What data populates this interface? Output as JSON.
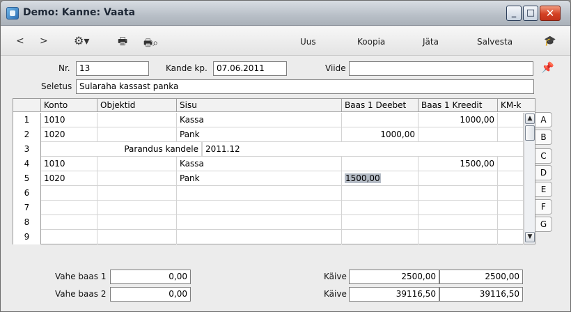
{
  "window": {
    "title": "Demo: Kanne: Vaata"
  },
  "toolbar": {
    "back_icon": "<",
    "forward_icon": ">",
    "new_label": "Uus",
    "copy_label": "Koopia",
    "skip_label": "Jäta",
    "save_label": "Salvesta"
  },
  "header": {
    "nr_label": "Nr.",
    "nr_value": "13",
    "date_label": "Kande kp.",
    "date_value": "07.06.2011",
    "ref_label": "Viide",
    "ref_value": "",
    "desc_label": "Seletus",
    "desc_value": "Sularaha kassast panka"
  },
  "grid": {
    "columns": [
      "",
      "Konto",
      "Objektid",
      "Sisu",
      "Baas 1 Deebet",
      "Baas 1 Kreedit",
      "KM-k"
    ],
    "rows": [
      {
        "n": "1",
        "konto": "1010",
        "objektid": "",
        "sisu": "Kassa",
        "deebet": "",
        "kreedit": "1000,00",
        "kmk": ""
      },
      {
        "n": "2",
        "konto": "1020",
        "objektid": "",
        "sisu": "Pank",
        "deebet": "1000,00",
        "kreedit": "",
        "kmk": ""
      },
      {
        "n": "3",
        "special_label": "Parandus kandele",
        "special_value": "2011.12"
      },
      {
        "n": "4",
        "konto": "1010",
        "objektid": "",
        "sisu": "Kassa",
        "deebet": "",
        "kreedit": "1500,00",
        "kmk": ""
      },
      {
        "n": "5",
        "konto": "1020",
        "objektid": "",
        "sisu": "Pank",
        "deebet": "1500,00",
        "kreedit": "",
        "kmk": ""
      },
      {
        "n": "6"
      },
      {
        "n": "7"
      },
      {
        "n": "8"
      },
      {
        "n": "9"
      }
    ],
    "selected_cell": {
      "row": 5,
      "column": "Baas 1 Deebet"
    }
  },
  "tabs": [
    "A",
    "B",
    "C",
    "D",
    "E",
    "F",
    "G"
  ],
  "footer": {
    "diff1_label": "Vahe baas 1",
    "diff1_value": "0,00",
    "diff2_label": "Vahe baas 2",
    "diff2_value": "0,00",
    "turnover1_label": "Käive",
    "turnover1_debit": "2500,00",
    "turnover1_credit": "2500,00",
    "turnover2_label": "Käive",
    "turnover2_debit": "39116,50",
    "turnover2_credit": "39116,50"
  },
  "colors": {
    "selection": "#b5bcc6",
    "close_button": "#d44124"
  }
}
